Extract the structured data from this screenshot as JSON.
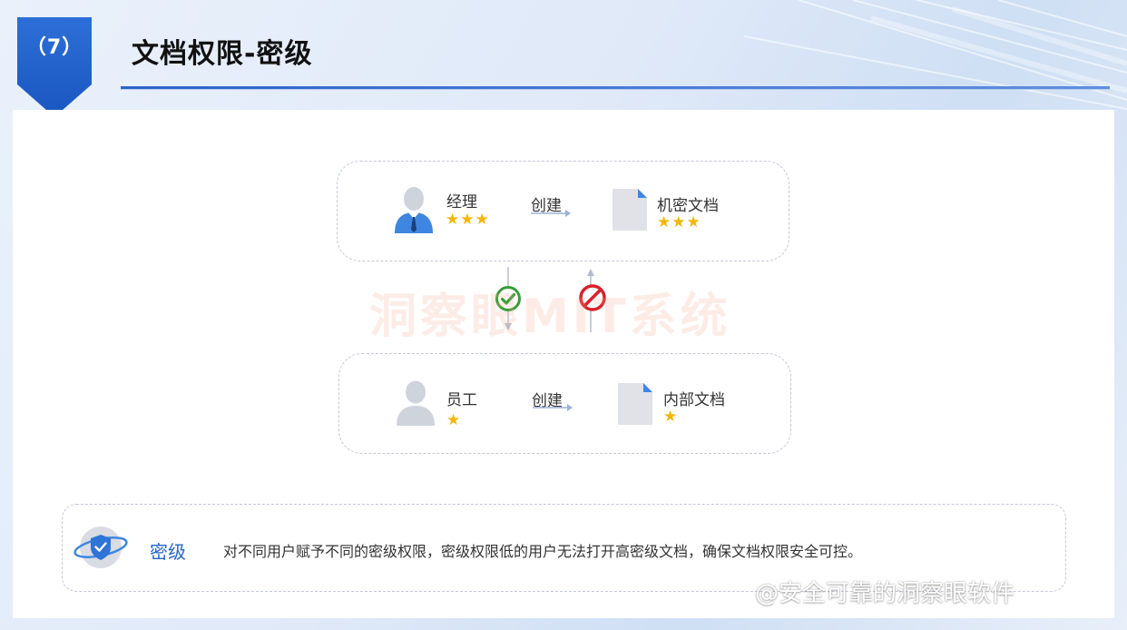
{
  "header": {
    "badge": "（7）",
    "title": "文档权限-密级"
  },
  "diagram": {
    "top_row": {
      "role": "经理",
      "role_stars": "★★★",
      "action": "创建",
      "doc": "机密文档",
      "doc_stars": "★★★"
    },
    "bottom_row": {
      "role": "员工",
      "role_stars": "★",
      "action": "创建",
      "doc": "内部文档",
      "doc_stars": "★"
    },
    "allowed_icon": "check-circle-icon",
    "denied_icon": "prohibited-icon",
    "watermark": "洞察眼MIT系统"
  },
  "info": {
    "title": "密级",
    "description": "对不同用户赋予不同的密级权限，密级权限低的用户无法打开高密级文档，确保文档权限安全可控。"
  },
  "footer": {
    "credit": "@安全可靠的洞察眼软件"
  },
  "colors": {
    "accent": "#2765c4",
    "star": "#f2b705",
    "allowed": "#3a9d3a",
    "denied": "#d9202a"
  }
}
